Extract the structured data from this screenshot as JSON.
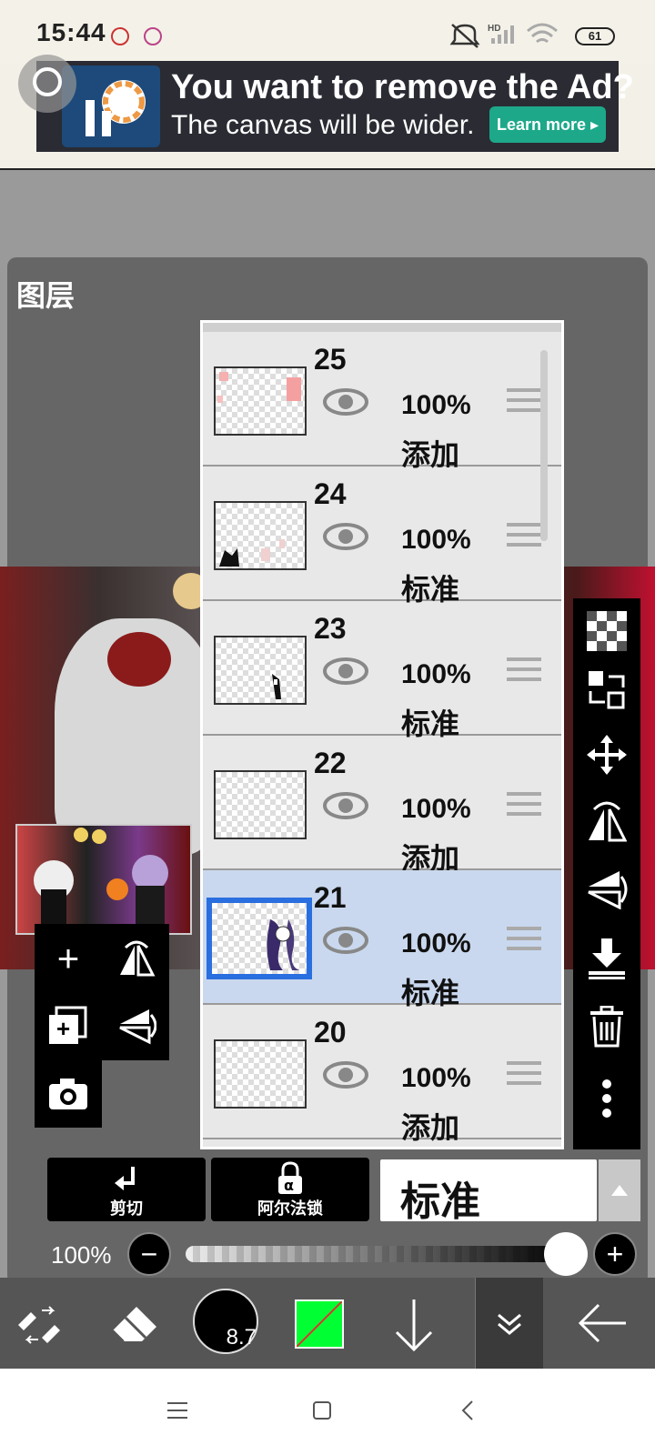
{
  "status_bar": {
    "time": "15:44",
    "battery": "61"
  },
  "ad": {
    "title": "You want to remove the Ad?",
    "subtitle": "The canvas will be wider.",
    "button": "Learn more ▸"
  },
  "panel": {
    "title": "图层"
  },
  "layers": [
    {
      "number": "25",
      "opacity": "100%",
      "blend": "添加",
      "selected": false
    },
    {
      "number": "24",
      "opacity": "100%",
      "blend": "标准",
      "selected": false
    },
    {
      "number": "23",
      "opacity": "100%",
      "blend": "标准",
      "selected": false
    },
    {
      "number": "22",
      "opacity": "100%",
      "blend": "添加",
      "selected": false
    },
    {
      "number": "21",
      "opacity": "100%",
      "blend": "标准",
      "selected": true
    },
    {
      "number": "20",
      "opacity": "100%",
      "blend": "添加",
      "selected": false
    }
  ],
  "controls": {
    "clip_label": "剪切",
    "alpha_lock_label": "阿尔法锁",
    "blend_mode": "标准",
    "opacity": "100%",
    "opacity_value": 1.0
  },
  "bottom_toolbar": {
    "brush_size": "8.7",
    "color_hex": "#00ff33"
  },
  "colors": {
    "accent_selection": "#2a6fe0",
    "selected_row": "#c9d8ee",
    "ad_button": "#1da88a"
  }
}
